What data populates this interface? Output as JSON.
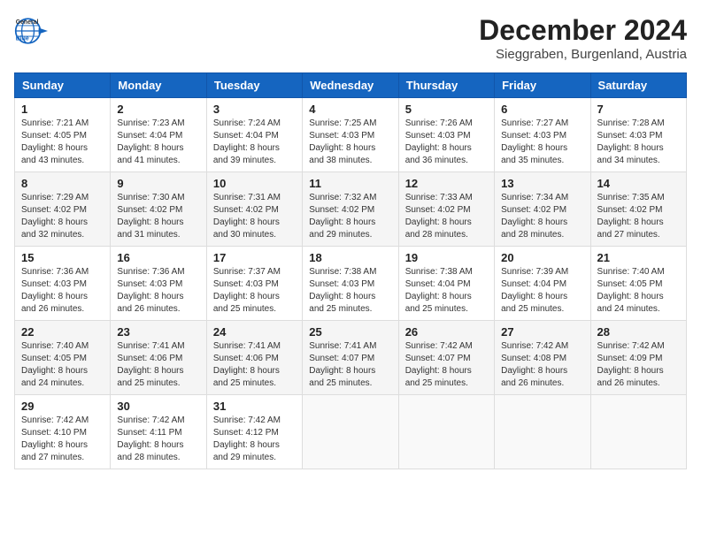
{
  "header": {
    "logo": {
      "general": "General",
      "blue": "Blue"
    },
    "title": "December 2024",
    "subtitle": "Sieggraben, Burgenland, Austria"
  },
  "calendar": {
    "weekdays": [
      "Sunday",
      "Monday",
      "Tuesday",
      "Wednesday",
      "Thursday",
      "Friday",
      "Saturday"
    ],
    "weeks": [
      [
        {
          "day": "1",
          "sunrise": "Sunrise: 7:21 AM",
          "sunset": "Sunset: 4:05 PM",
          "daylight": "Daylight: 8 hours and 43 minutes."
        },
        {
          "day": "2",
          "sunrise": "Sunrise: 7:23 AM",
          "sunset": "Sunset: 4:04 PM",
          "daylight": "Daylight: 8 hours and 41 minutes."
        },
        {
          "day": "3",
          "sunrise": "Sunrise: 7:24 AM",
          "sunset": "Sunset: 4:04 PM",
          "daylight": "Daylight: 8 hours and 39 minutes."
        },
        {
          "day": "4",
          "sunrise": "Sunrise: 7:25 AM",
          "sunset": "Sunset: 4:03 PM",
          "daylight": "Daylight: 8 hours and 38 minutes."
        },
        {
          "day": "5",
          "sunrise": "Sunrise: 7:26 AM",
          "sunset": "Sunset: 4:03 PM",
          "daylight": "Daylight: 8 hours and 36 minutes."
        },
        {
          "day": "6",
          "sunrise": "Sunrise: 7:27 AM",
          "sunset": "Sunset: 4:03 PM",
          "daylight": "Daylight: 8 hours and 35 minutes."
        },
        {
          "day": "7",
          "sunrise": "Sunrise: 7:28 AM",
          "sunset": "Sunset: 4:03 PM",
          "daylight": "Daylight: 8 hours and 34 minutes."
        }
      ],
      [
        {
          "day": "8",
          "sunrise": "Sunrise: 7:29 AM",
          "sunset": "Sunset: 4:02 PM",
          "daylight": "Daylight: 8 hours and 32 minutes."
        },
        {
          "day": "9",
          "sunrise": "Sunrise: 7:30 AM",
          "sunset": "Sunset: 4:02 PM",
          "daylight": "Daylight: 8 hours and 31 minutes."
        },
        {
          "day": "10",
          "sunrise": "Sunrise: 7:31 AM",
          "sunset": "Sunset: 4:02 PM",
          "daylight": "Daylight: 8 hours and 30 minutes."
        },
        {
          "day": "11",
          "sunrise": "Sunrise: 7:32 AM",
          "sunset": "Sunset: 4:02 PM",
          "daylight": "Daylight: 8 hours and 29 minutes."
        },
        {
          "day": "12",
          "sunrise": "Sunrise: 7:33 AM",
          "sunset": "Sunset: 4:02 PM",
          "daylight": "Daylight: 8 hours and 28 minutes."
        },
        {
          "day": "13",
          "sunrise": "Sunrise: 7:34 AM",
          "sunset": "Sunset: 4:02 PM",
          "daylight": "Daylight: 8 hours and 28 minutes."
        },
        {
          "day": "14",
          "sunrise": "Sunrise: 7:35 AM",
          "sunset": "Sunset: 4:02 PM",
          "daylight": "Daylight: 8 hours and 27 minutes."
        }
      ],
      [
        {
          "day": "15",
          "sunrise": "Sunrise: 7:36 AM",
          "sunset": "Sunset: 4:03 PM",
          "daylight": "Daylight: 8 hours and 26 minutes."
        },
        {
          "day": "16",
          "sunrise": "Sunrise: 7:36 AM",
          "sunset": "Sunset: 4:03 PM",
          "daylight": "Daylight: 8 hours and 26 minutes."
        },
        {
          "day": "17",
          "sunrise": "Sunrise: 7:37 AM",
          "sunset": "Sunset: 4:03 PM",
          "daylight": "Daylight: 8 hours and 25 minutes."
        },
        {
          "day": "18",
          "sunrise": "Sunrise: 7:38 AM",
          "sunset": "Sunset: 4:03 PM",
          "daylight": "Daylight: 8 hours and 25 minutes."
        },
        {
          "day": "19",
          "sunrise": "Sunrise: 7:38 AM",
          "sunset": "Sunset: 4:04 PM",
          "daylight": "Daylight: 8 hours and 25 minutes."
        },
        {
          "day": "20",
          "sunrise": "Sunrise: 7:39 AM",
          "sunset": "Sunset: 4:04 PM",
          "daylight": "Daylight: 8 hours and 25 minutes."
        },
        {
          "day": "21",
          "sunrise": "Sunrise: 7:40 AM",
          "sunset": "Sunset: 4:05 PM",
          "daylight": "Daylight: 8 hours and 24 minutes."
        }
      ],
      [
        {
          "day": "22",
          "sunrise": "Sunrise: 7:40 AM",
          "sunset": "Sunset: 4:05 PM",
          "daylight": "Daylight: 8 hours and 24 minutes."
        },
        {
          "day": "23",
          "sunrise": "Sunrise: 7:41 AM",
          "sunset": "Sunset: 4:06 PM",
          "daylight": "Daylight: 8 hours and 25 minutes."
        },
        {
          "day": "24",
          "sunrise": "Sunrise: 7:41 AM",
          "sunset": "Sunset: 4:06 PM",
          "daylight": "Daylight: 8 hours and 25 minutes."
        },
        {
          "day": "25",
          "sunrise": "Sunrise: 7:41 AM",
          "sunset": "Sunset: 4:07 PM",
          "daylight": "Daylight: 8 hours and 25 minutes."
        },
        {
          "day": "26",
          "sunrise": "Sunrise: 7:42 AM",
          "sunset": "Sunset: 4:07 PM",
          "daylight": "Daylight: 8 hours and 25 minutes."
        },
        {
          "day": "27",
          "sunrise": "Sunrise: 7:42 AM",
          "sunset": "Sunset: 4:08 PM",
          "daylight": "Daylight: 8 hours and 26 minutes."
        },
        {
          "day": "28",
          "sunrise": "Sunrise: 7:42 AM",
          "sunset": "Sunset: 4:09 PM",
          "daylight": "Daylight: 8 hours and 26 minutes."
        }
      ],
      [
        {
          "day": "29",
          "sunrise": "Sunrise: 7:42 AM",
          "sunset": "Sunset: 4:10 PM",
          "daylight": "Daylight: 8 hours and 27 minutes."
        },
        {
          "day": "30",
          "sunrise": "Sunrise: 7:42 AM",
          "sunset": "Sunset: 4:11 PM",
          "daylight": "Daylight: 8 hours and 28 minutes."
        },
        {
          "day": "31",
          "sunrise": "Sunrise: 7:42 AM",
          "sunset": "Sunset: 4:12 PM",
          "daylight": "Daylight: 8 hours and 29 minutes."
        },
        null,
        null,
        null,
        null
      ]
    ]
  }
}
